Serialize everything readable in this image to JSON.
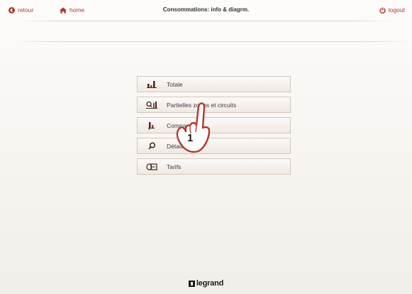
{
  "header": {
    "back_label": "retour",
    "home_label": "home",
    "title": "Consommations: info & diagrm.",
    "logout_label": "logout"
  },
  "menu": {
    "items": [
      {
        "label": "Totale",
        "icon": "bar-chart-icon"
      },
      {
        "label": "Partielles zones et circuits",
        "icon": "zoom-chart-icon"
      },
      {
        "label": "Comparaison",
        "icon": "compare-chart-icon"
      },
      {
        "label": "Détails",
        "icon": "magnifier-icon"
      },
      {
        "label": "Tarifs",
        "icon": "money-icon"
      }
    ]
  },
  "callout": {
    "step_number": "1"
  },
  "footer": {
    "logo_text": "legrand"
  },
  "colors": {
    "accent": "#b0392e",
    "text": "#333333",
    "border": "#d2c7bc"
  }
}
